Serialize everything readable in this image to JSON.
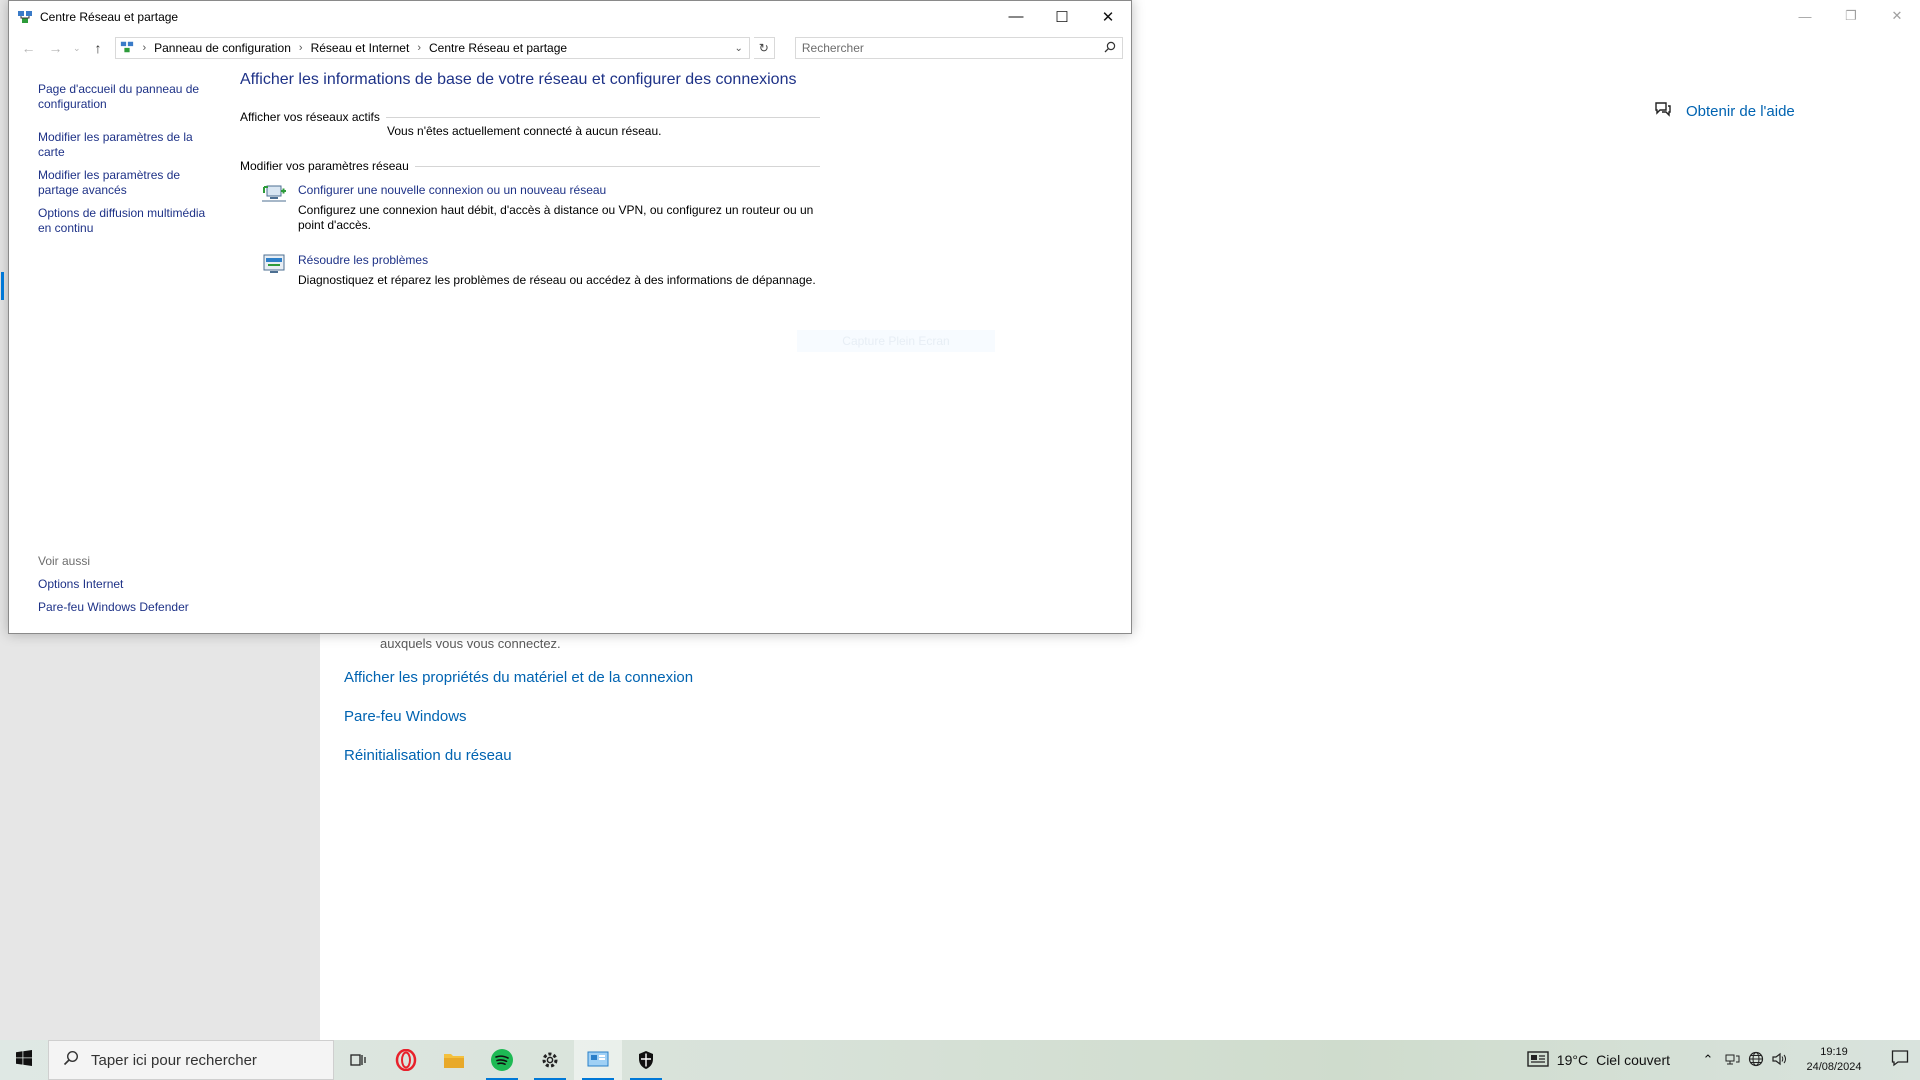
{
  "window": {
    "title": "Centre Réseau et partage",
    "controls": {
      "minimize": "—",
      "maximize": "☐",
      "close": "✕"
    }
  },
  "address": {
    "crumbs": [
      "Panneau de configuration",
      "Réseau et Internet",
      "Centre Réseau et partage"
    ],
    "search_placeholder": "Rechercher"
  },
  "sidebar": {
    "home": "Page d'accueil du panneau de configuration",
    "adapter": "Modifier les paramètres de la carte",
    "advanced": "Modifier les paramètres de partage avancés",
    "streaming": "Options de diffusion multimédia en continu",
    "see_also": "Voir aussi",
    "internet_options": "Options Internet",
    "firewall": "Pare-feu Windows Defender"
  },
  "main": {
    "title": "Afficher les informations de base de votre réseau et configurer des connexions",
    "active_networks": "Afficher vos réseaux actifs",
    "no_network": "Vous n'êtes actuellement connecté à aucun réseau.",
    "change_settings": "Modifier vos paramètres réseau",
    "task_new": {
      "label": "Configurer une nouvelle connexion ou un nouveau réseau",
      "desc": "Configurez une connexion haut débit, d'accès à distance ou VPN, ou configurez un routeur ou un point d'accès."
    },
    "task_troubleshoot": {
      "label": "Résoudre les problèmes",
      "desc": "Diagnostiquez et réparez les problèmes de réseau ou accédez à des informations de dépannage."
    },
    "ghost_button": "Capture Plein Ecran"
  },
  "background": {
    "help": "Obtenir de l'aide",
    "partial_text": "auxquels vous vous connectez.",
    "links": [
      "Afficher les propriétés du matériel et de la connexion",
      "Pare-feu Windows",
      "Réinitialisation du réseau"
    ]
  },
  "taskbar": {
    "search_placeholder": "Taper ici pour rechercher",
    "weather_temp": "19°C",
    "weather_desc": "Ciel couvert",
    "time": "19:19",
    "date": "24/08/2024"
  },
  "colors": {
    "link": "#1e3287",
    "settings_link": "#0063b1",
    "accent": "#0078d7"
  }
}
